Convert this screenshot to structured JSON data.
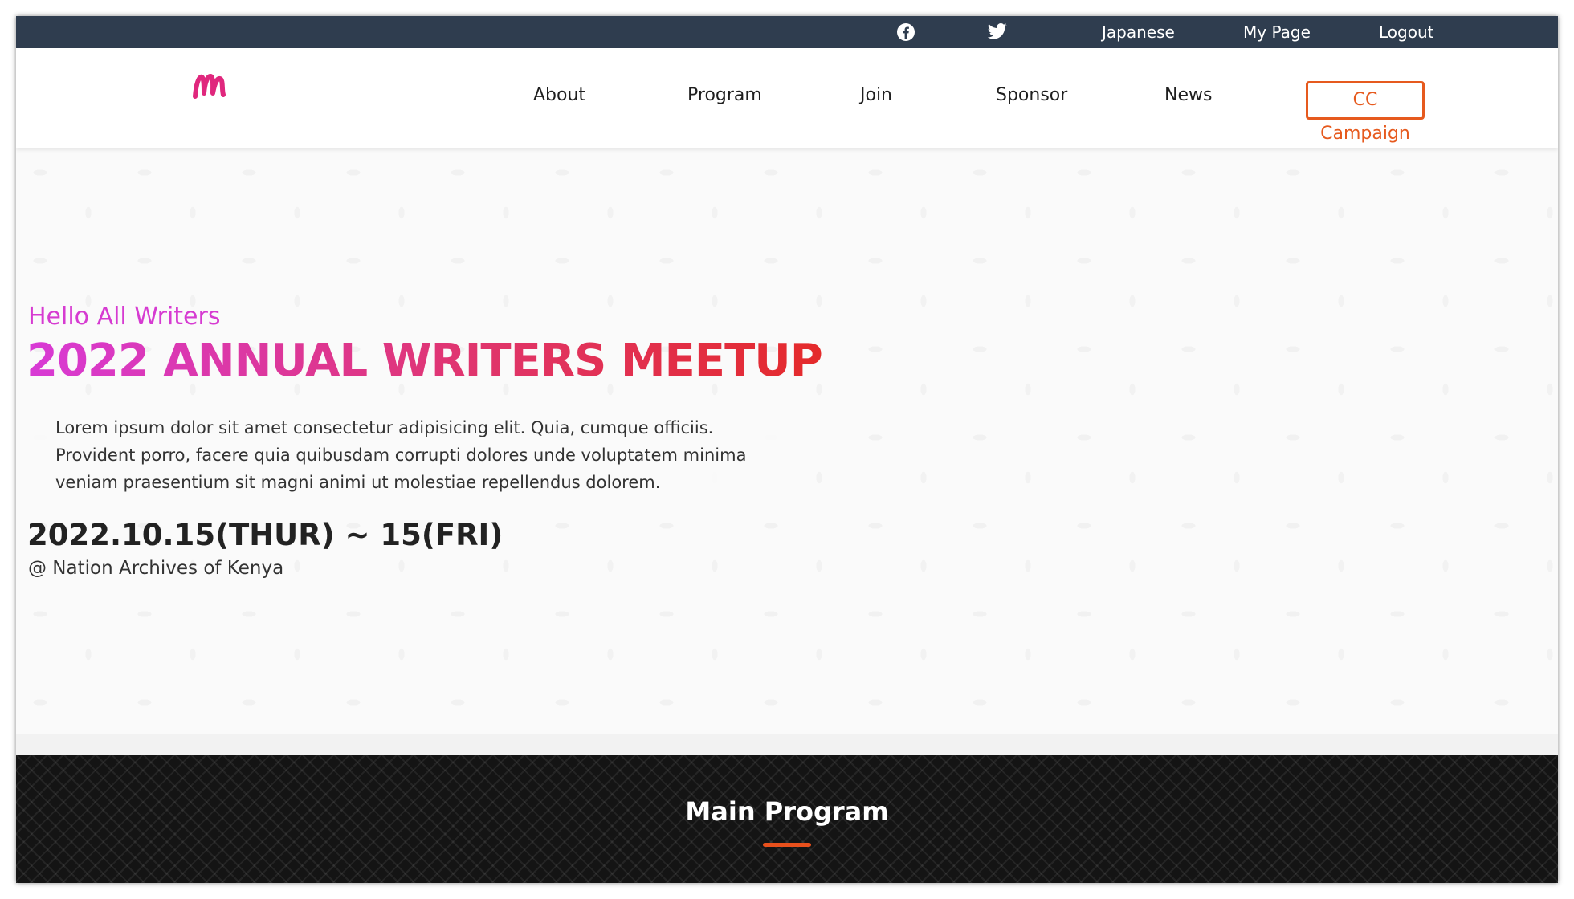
{
  "topbar": {
    "icons": [
      "facebook-icon",
      "twitter-icon"
    ],
    "language_link": "Japanese",
    "mypage_link": "My Page",
    "logout_link": "Logout"
  },
  "nav": {
    "logo_icon": "brand-logo",
    "items": [
      "About",
      "Program",
      "Join",
      "Sponsor",
      "News"
    ],
    "cta": "CC Campaign"
  },
  "hero": {
    "greeting": "Hello All Writers",
    "title": "2022 ANNUAL WRITERS MEETUP",
    "description": "Lorem ipsum dolor sit amet consectetur adipisicing elit. Quia, cumque officiis. Provident porro, facere quia quibusdam corrupti dolores unde voluptatem minima veniam praesentium sit magni animi ut molestiae repellendus dolorem.",
    "date": "2022.10.15(THUR) ~ 15(FRI)",
    "venue": "@ Nation Archives of Kenya"
  },
  "program": {
    "heading": "Main Program"
  },
  "colors": {
    "topbar": "#2f3d4f",
    "accent": "#e65a1e",
    "greeting": "#d63bd1",
    "title_start": "#d83ad6",
    "title_end": "#e42a2a"
  }
}
